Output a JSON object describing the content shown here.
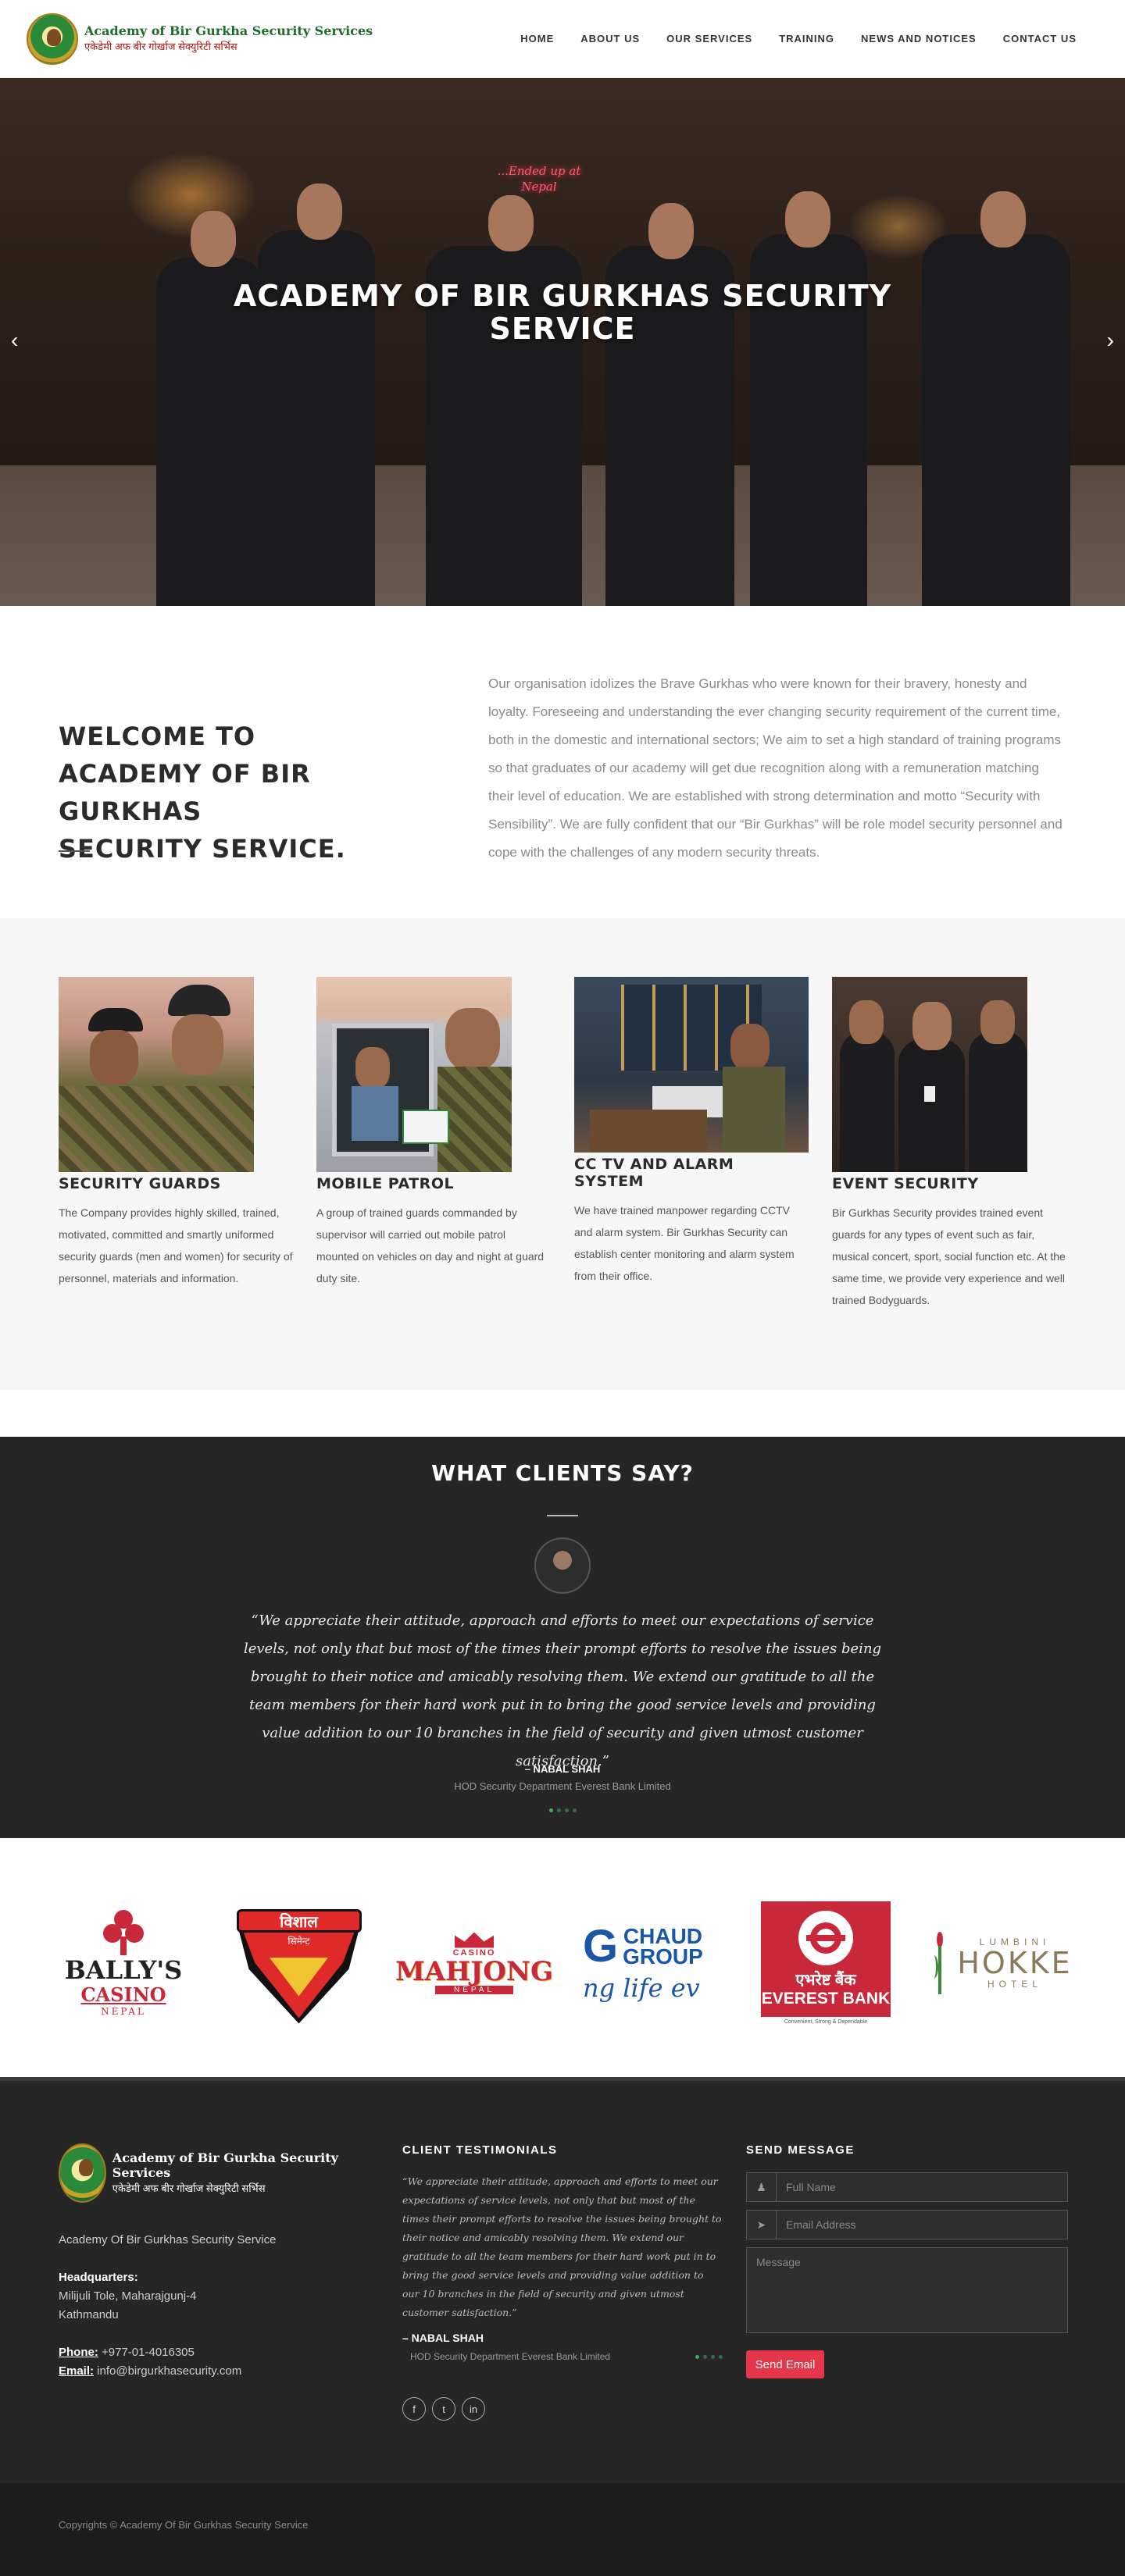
{
  "header": {
    "logo_en": "Academy of Bir Gurkha Security Services",
    "logo_np": "एकेडेमी अफ बीर गोर्खाज सेक्युरिटी सर्भिस",
    "nav": [
      "HOME",
      "ABOUT US",
      "OUR SERVICES",
      "TRAINING",
      "NEWS AND NOTICES",
      "CONTACT US"
    ]
  },
  "hero": {
    "title_line1": "ACADEMY OF BIR GURKHAS SECURITY",
    "title_line2": "SERVICE",
    "neon_sign_line1": "...Ended up at",
    "neon_sign_line2": "Nepal",
    "prev_icon": "chevron-left-icon",
    "next_icon": "chevron-right-icon"
  },
  "welcome": {
    "title_line1": "WELCOME TO",
    "title_line2": "ACADEMY OF BIR GURKHAS",
    "title_line3": "SECURITY SERVICE.",
    "body": "Our organisation idolizes the Brave Gurkhas who were known for their bravery, honesty and loyalty. Foreseeing and understanding the ever changing security requirement of the current time, both in the domestic and international sectors; We aim to set a high standard of training programs so that graduates of our academy will get due recognition along with a remuneration matching their level of education. We are established with strong determination and motto “Security with Sensibility”. We are fully confident that our “Bir Gurkhas” will be role model security personnel and cope with the challenges of any modern security threats."
  },
  "services": [
    {
      "title": "SECURITY GUARDS",
      "text": "The Company provides highly skilled, trained, motivated, committed and smartly uniformed security guards (men and women) for security of personnel, materials and information."
    },
    {
      "title": "MOBILE PATROL",
      "text": "A group of trained guards commanded by supervisor will carried out mobile patrol mounted on vehicles on day and night at guard duty site."
    },
    {
      "title": "CC TV AND ALARM SYSTEM",
      "text": "We have trained manpower regarding CCTV and alarm system. Bir Gurkhas Security can establish center monitoring and alarm system from their office."
    },
    {
      "title": "EVENT SECURITY",
      "text": "Bir Gurkhas Security provides trained event guards for any types of event such as fair, musical concert, sport, social function etc. At the same time, we provide very experience and well trained Bodyguards."
    }
  ],
  "testimonials": {
    "heading": "WHAT CLIENTS SAY?",
    "quote": "“We appreciate their attitude, approach and efforts to meet our expectations of service levels, not only that but most of the times their prompt efforts to resolve the issues being brought to their notice and amicably resolving them. We extend our gratitude to all the team members for their hard work put in to bring the good service levels and providing value addition to our 10 branches in the field of security and given utmost customer satisfaction.”",
    "author": "– NABAL SHAH",
    "role": "HOD Security Department Everest Bank Limited"
  },
  "clients": {
    "ballys_1": "BALLY'S",
    "ballys_2": "CASINO",
    "ballys_3": "NEPAL",
    "bishal_1": "विशाल",
    "bishal_2": "सिमेन्ट",
    "mahjong_1": "CASINO",
    "mahjong_2": "MAHJONG",
    "mahjong_3": "NEPAL",
    "chaud_1": "CHAUD",
    "chaud_2": "GROUP",
    "chaud_3": "ng life ev",
    "everest_1": "एभरेष्ट बैंक",
    "everest_2": "EVEREST BANK",
    "everest_3": "Convenient, Strong & Dependable",
    "hokke_1": "LUMBINI",
    "hokke_2": "HOKKE",
    "hokke_3": "HOTEL"
  },
  "footer": {
    "logo_en": "Academy of Bir Gurkha Security Services",
    "logo_np": "एकेडेमी अफ बीर गोर्खाज सेक्युरिटी सर्भिस",
    "org_name": "Academy Of Bir Gurkhas Security Service",
    "hq_label": "Headquarters:",
    "hq_line1": "Milijuli Tole, Maharajgunj-4",
    "hq_line2": "Kathmandu",
    "phone_label": "Phone:",
    "phone": " +977-01-4016305",
    "email_label": "Email:",
    "email": " info@birgurkhasecurity.com",
    "testimonials_heading": "CLIENT TESTIMONIALS",
    "testimonial_quote": "“We appreciate their attitude, approach and efforts to meet our expectations of service levels, not only that but most of the times their prompt efforts to resolve the issues being brought to their notice and amicably resolving them. We extend our gratitude to all the team members for their hard work put in to bring the good service levels and providing value addition to our 10 branches in the field of security and given utmost customer satisfaction.”",
    "testimonial_author": "– NABAL SHAH",
    "testimonial_role": "HOD Security Department Everest Bank Limited",
    "send_heading": "SEND MESSAGE",
    "name_placeholder": "Full Name",
    "email_placeholder": "Email Address",
    "message_placeholder": "Message",
    "send_button": "Send Email",
    "social": [
      {
        "icon": "facebook-icon",
        "glyph": "f"
      },
      {
        "icon": "twitter-icon",
        "glyph": "t"
      },
      {
        "icon": "linkedin-icon",
        "glyph": "in"
      }
    ]
  },
  "copyright": "Copyrights © Academy Of Bir Gurkhas Security Service",
  "colors": {
    "accent_red": "#e5364a",
    "logo_green": "#1e6b2a",
    "dark_bg": "#262626"
  }
}
